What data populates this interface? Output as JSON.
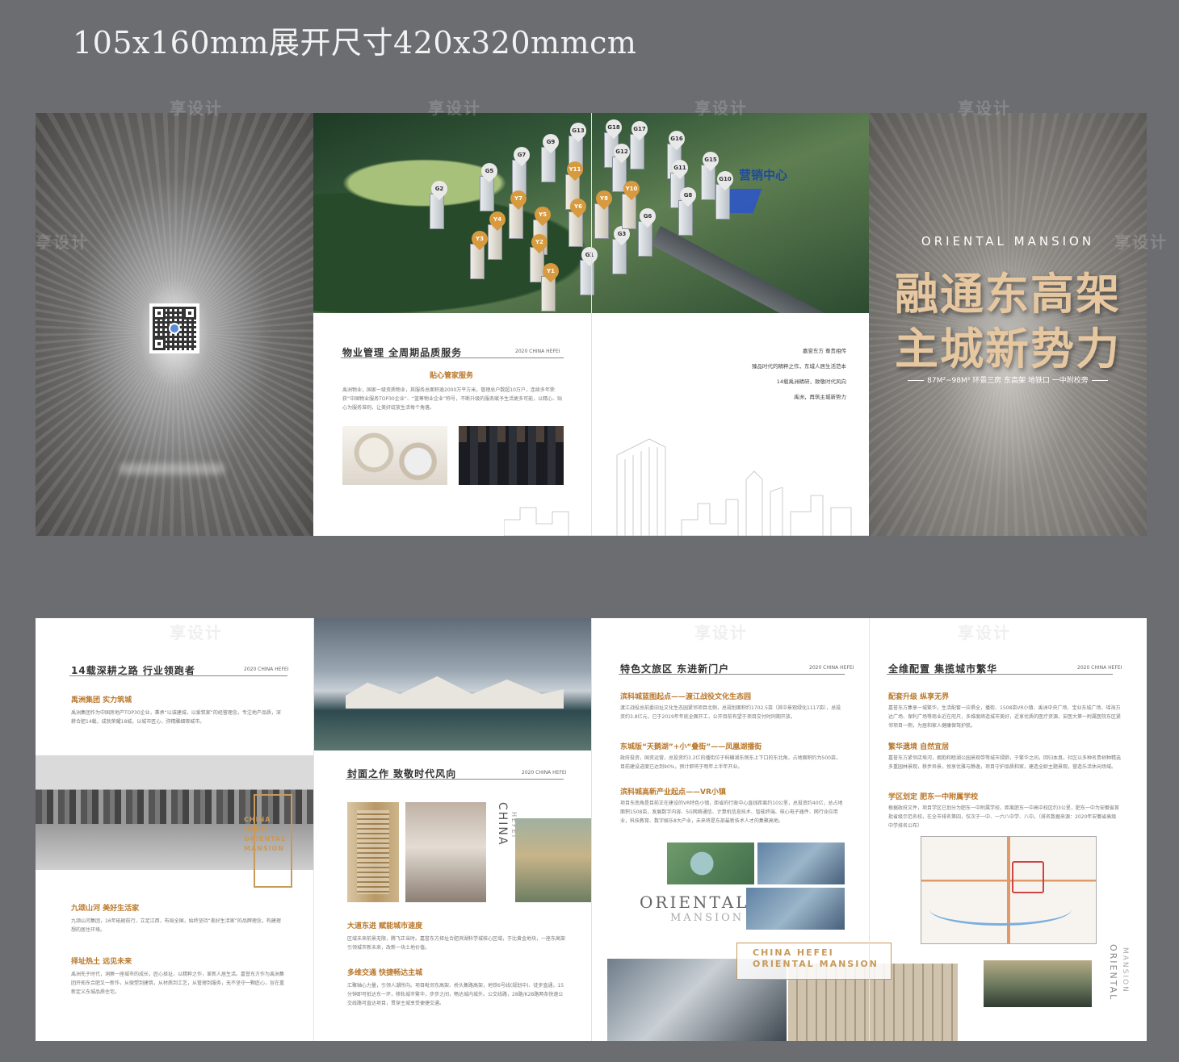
{
  "title": "105x160mm展开尺寸420x320mmcm",
  "outside": {
    "aerial": {
      "sales_center": "营销中心",
      "pins_grey": [
        "G18",
        "G17",
        "G13",
        "G16",
        "G9",
        "G12",
        "G7",
        "G15",
        "G11",
        "G5",
        "G10",
        "G2",
        "G8",
        "G6",
        "G3",
        "G1"
      ],
      "pins_gold": [
        "Y11",
        "Y10",
        "Y8",
        "Y7",
        "Y6",
        "Y5",
        "Y4",
        "Y3",
        "Y2",
        "Y1"
      ]
    },
    "property": {
      "heading": "物业管理 全周期品质服务",
      "year": "2020 CHINA HEFEI",
      "subheading": "贴心管家服务",
      "body": "禹洲物业，国家一级资质物业，其服务总面积逾2000万平方米，管理总户数超10万户，连续多年荣获“中国物业服务TOP30企业”、“蓝筹物业企业”称号，不断升级的服务赋予生活更多可能，以精心、贴心为服务准则，让美好绽放生活每个角落。"
    },
    "slogans": [
      "嘉誉东方 尊贵相传",
      "臻品时代的精粹之作，东城人居生活范本",
      "14载禹洲精研，致敬时代风向",
      "禹洲，再筑主城新势力"
    ],
    "cover": {
      "brand_en": "ORIENTAL MANSION",
      "headline_1": "融通东高架",
      "headline_2": "主城新势力",
      "features": "87M²~98M² 环景三房  东高架  地铁口  一中附校旁"
    }
  },
  "inside": {
    "panel1": {
      "heading": "14载深耕之路 行业领跑者",
      "year": "2020 CHINA HEFEI",
      "sub1": "禹洲集团 实力筑城",
      "body1": "禹洲集团作为中国房地产TOP30企业，秉承“以诚建城，以爱筑家”的经营理念，专注地产品质，深耕合肥14载，成就荣耀18城，以城市匠心，弥精雕细琢城市。",
      "caps": [
        "CHINA",
        "HEFEI",
        "ORIENTAL",
        "MANSION"
      ],
      "sub2": "九颂山河 美好生活家",
      "body2": "九颂山河集团，16年砥砺前行，立足江西，布局全国，始终坚持“美好生活家”的品牌理念，构建理想的居住环境。",
      "sub3": "择址热土 远见未来",
      "body3": "禹洲先于时代，洞察一座城市的成长，匠心择址，以精粹之作，革新人居生活。嘉誉东方作为禹洲集团开拓东合肥又一新作，从微塑到建筑，从材质到工艺，从管理到服务，无不坚守一颗匠心，旨在重新定义东城品质住宅。"
    },
    "panel2": {
      "heading": "封面之作 致敬时代风向",
      "year": "2020 CHINA HEFEI",
      "vert_1": "CHINA",
      "vert_2": "HEFEI",
      "sub1": "大道东进 赋能城市速度",
      "body1": "区域未来前景无限，腾飞正当时。嘉誉东方择址合肥滨湖科学城核心区域，于比黄金地块，一座东高架引领城市新未来，改新一块土地价值。",
      "sub2": "多维交通 快捷畅达主城",
      "body2": "汇聚轴心力量，引领人潮所向。项目毗邻东高架、桥头集路高架，地铁6号线(规划中)、徒步直通，15分钟即可抵达东一环，移轨城市繁华，步步之间，畅达城内城外。公交线路，28路/K28路两条快速公交线路可直达项目，贯穿主城享受便捷交通。"
    },
    "panel3": {
      "heading": "特色文旅区 东进新门户",
      "year": "2020 CHINA HEFEI",
      "sub1": "滨科城蓝图起点——渡江战役文化生态园",
      "body1": "渡江战役总前委旧址文化生态园紧邻项目北侧，总规划面积约1702.5亩（其中景观绿化1117亩），总投资约3.8亿元，已于2019年年底全面开工，公开目前有望于项目交付时同期开放。",
      "sub2": "东城版“天鹅湖”+小“叠街”——凤凰湖播街",
      "body2": "政府投资，国资运营，总投资约3.2亿的播街位于蚂蟥湖东侧东上下口的东北角，占地面积约为500亩，目前建设进度已达到90%，预计即将于明年上半年开业。",
      "sub3": "滨科城高新产业起点——VR小镇",
      "body3": "项目东南角是目前正在建设的VR特色小镇，距省的行政中心直线距离约10公里，总投资约40亿，总占地面积1508亩，发展数字内容、5G网络通信、计算机信息技术、智能终端、核心电子器件、网行业应用业，科技教育、数字娱乐8大产业，未来将是东部最新技术人才的集聚高地。",
      "oriental": "ORIENTAL",
      "mansion": "MANSION",
      "caption_1": "CHINA HEFEI",
      "caption_2": "ORIENTAL MANSION"
    },
    "panel4": {
      "heading": "全维配置 集揽城市繁华",
      "year": "2020 CHINA HEFEI",
      "sub1": "配套升级 纵享无界",
      "body1": "嘉誉东方集享一城繁华，生活配套一应俱全，播街、1508亩VR小镇、禹洲中央广场、宝业东城广场、瑶海万达广场、保利广场等商业近在咫尺，多维度缔造城市美好，近享优质的医疗资源，安医大第一附属医院东区紧邻项目一侧，为居和家人健康保驾护航。",
      "sub2": "繁华遗境 自然宜居",
      "body2": "嘉誉东方紧邻店埠河，拥抱和睦湖公园景观带等城市绿肺，于繁华之间，回归本真，社区以多种名贵树种精选多重园林景观，移步异景，悦享优雅与静逸，项目守护品质和家，建造全龄主题景观，营造乐活休闲场域。",
      "sub3": "学区划定 肥东一中附属学校",
      "body3": "根据政府文件，项目学区已划分为肥东一中附属学校，距离肥东一中高中校区约3公里，肥东一中为安徽省首批省级示范名校，在全市排名第四，仅次于一中、一六八中学、八中。（排名数据来源：2020年安徽省高级中学排名公布）",
      "vert_1": "ORIENTAL",
      "vert_2": "MANSION"
    }
  },
  "watermark": "享设计"
}
